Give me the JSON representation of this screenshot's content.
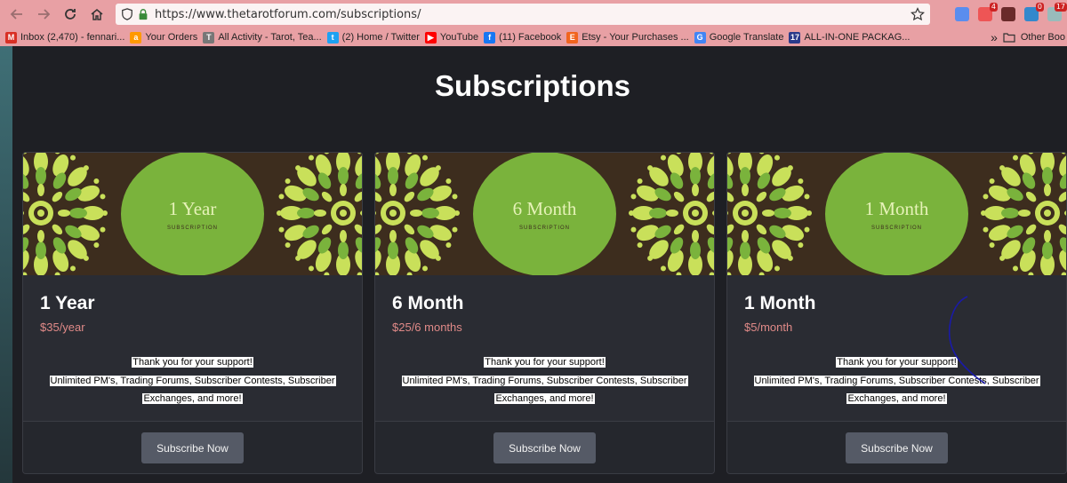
{
  "browser": {
    "url": "https://www.thetarotforum.com/subscriptions/",
    "extensions": [
      {
        "name": "download-icon",
        "color": "#5a8dee",
        "badge": ""
      },
      {
        "name": "extension-badge-4-icon",
        "color": "#e55",
        "badge": "4"
      },
      {
        "name": "extension-dark-icon",
        "color": "#6a2a2a",
        "badge": ""
      },
      {
        "name": "extension-badge-0-icon",
        "color": "#38c",
        "badge": "0"
      },
      {
        "name": "extension-cloud-icon",
        "color": "#9bb",
        "badge": "17"
      }
    ]
  },
  "bookmarks": [
    {
      "label": "Inbox (2,470) - fennari...",
      "icon": "gmail-icon",
      "color": "#d93025",
      "glyph": "M"
    },
    {
      "label": "Your Orders",
      "icon": "amazon-icon",
      "color": "#f90",
      "glyph": "a"
    },
    {
      "label": "All Activity - Tarot, Tea...",
      "icon": "tarot-forum-icon",
      "color": "#777",
      "glyph": "T"
    },
    {
      "label": "(2) Home / Twitter",
      "icon": "twitter-icon",
      "color": "#1da1f2",
      "glyph": "t"
    },
    {
      "label": "YouTube",
      "icon": "youtube-icon",
      "color": "#f00",
      "glyph": "▶"
    },
    {
      "label": "(11) Facebook",
      "icon": "facebook-icon",
      "color": "#1877f2",
      "glyph": "f"
    },
    {
      "label": "Etsy - Your Purchases ...",
      "icon": "etsy-icon",
      "color": "#f1641e",
      "glyph": "E"
    },
    {
      "label": "Google Translate",
      "icon": "google-translate-icon",
      "color": "#4285f4",
      "glyph": "G"
    },
    {
      "label": "ALL-IN-ONE PACKAG...",
      "icon": "bookmark-17-icon",
      "color": "#2b3a8a",
      "glyph": "17"
    }
  ],
  "other_bookmarks": "Other Boo",
  "page": {
    "title": "Subscriptions"
  },
  "plans": [
    {
      "banner_title": "1 Year",
      "banner_sub": "SUBSCRIPTION",
      "name": "1 Year",
      "price": "$35/year",
      "desc_line1": "Thank you for your support!",
      "desc_line2": "Unlimited PM's, Trading Forums, Subscriber Contests, Subscriber",
      "desc_line3": "Exchanges, and more!",
      "button": "Subscribe Now"
    },
    {
      "banner_title": "6 Month",
      "banner_sub": "SUBSCRIPTION",
      "name": "6 Month",
      "price": "$25/6 months",
      "desc_line1": "Thank you for your support!",
      "desc_line2": "Unlimited PM's, Trading Forums, Subscriber Contests, Subscriber",
      "desc_line3": "Exchanges, and more!",
      "button": "Subscribe Now"
    },
    {
      "banner_title": "1 Month",
      "banner_sub": "SUBSCRIPTION",
      "name": "1 Month",
      "price": "$5/month",
      "desc_line1": "Thank you for your support!",
      "desc_line2": "Unlimited PM's, Trading Forums, Subscriber Contests, Subscriber",
      "desc_line3": "Exchanges, and more!",
      "button": "Subscribe Now"
    }
  ],
  "colors": {
    "background": "#1e1f24",
    "card": "#2a2c33",
    "banner_brown": "#3d2d1e",
    "banner_green": "#7ab33c",
    "accent_price": "#e08a88",
    "button": "#555a66",
    "chrome": "#e8a0a4"
  }
}
